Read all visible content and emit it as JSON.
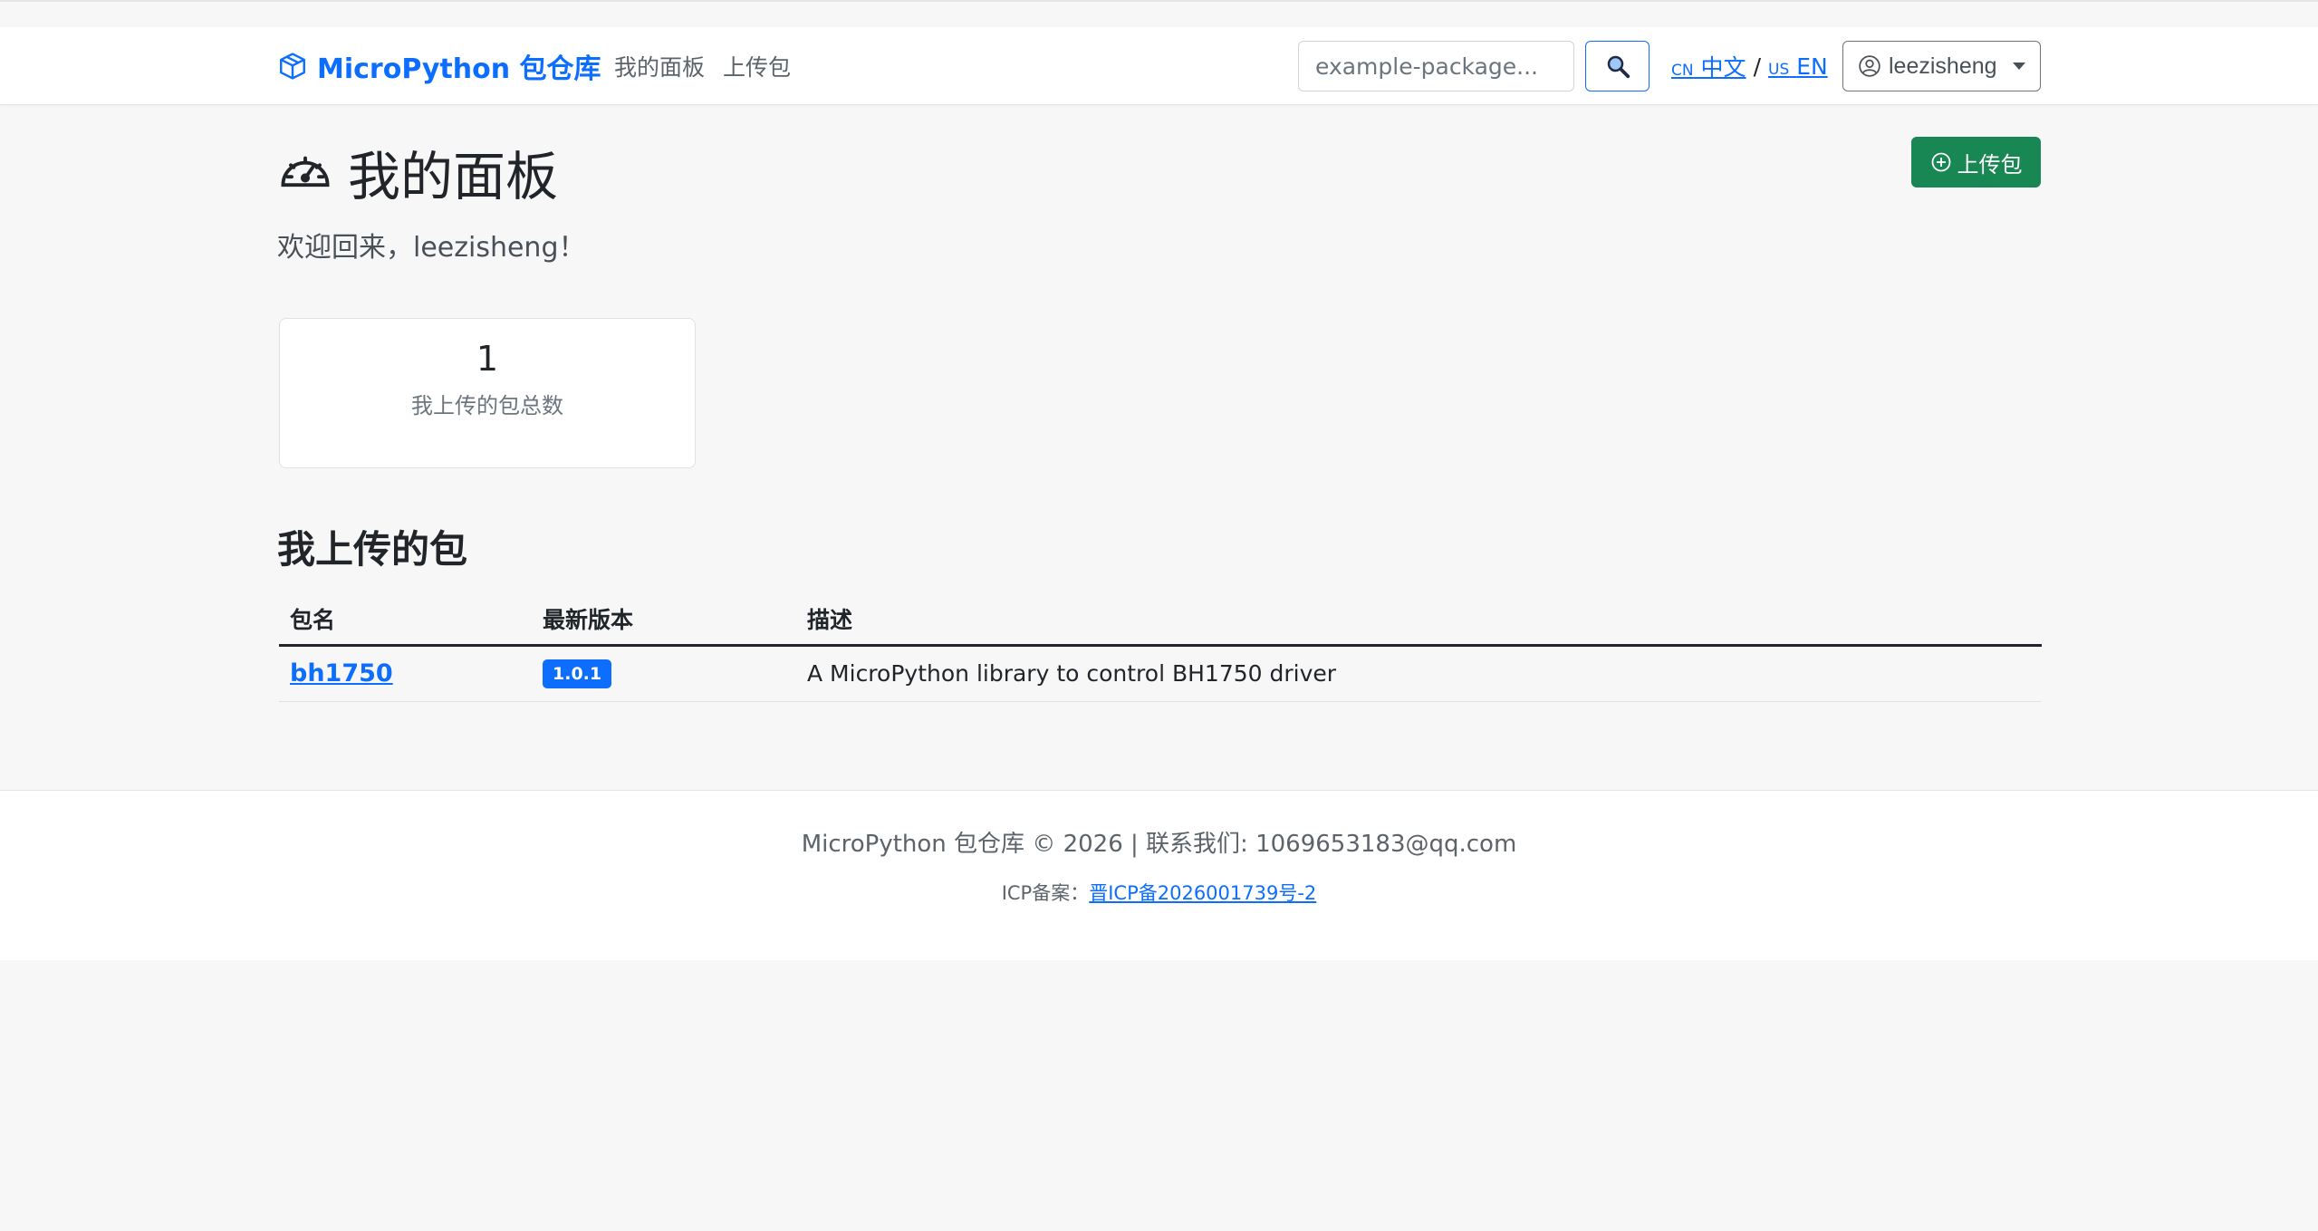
{
  "navbar": {
    "brand": "MicroPython 包仓库",
    "links": [
      "我的面板",
      "上传包"
    ],
    "search_placeholder": "example-package...",
    "lang_cn_code": "CN",
    "lang_cn_label": "中文",
    "lang_separator": "/",
    "lang_us_code": "US",
    "lang_en_label": "EN",
    "username": "leezisheng"
  },
  "main": {
    "title": "我的面板",
    "upload_button": "上传包",
    "welcome": "欢迎回来，leezisheng！",
    "stat": {
      "value": "1",
      "label": "我上传的包总数"
    },
    "section_title": "我上传的包",
    "table": {
      "headers": [
        "包名",
        "最新版本",
        "描述"
      ],
      "rows": [
        {
          "name": "bh1750",
          "version": "1.0.1",
          "description": "A MicroPython library to control BH1750 driver"
        }
      ]
    }
  },
  "footer": {
    "copyright": "MicroPython 包仓库 © 2026 | 联系我们: 1069653183@qq.com",
    "icp_label": "ICP备案：",
    "icp_link": "晋ICP备2026001739号-2"
  },
  "colors": {
    "primary": "#0d6efd",
    "success": "#198754",
    "background": "#f7f7f8"
  },
  "icons": [
    "box-icon",
    "search-icon",
    "user-circle-icon",
    "speedometer-icon",
    "plus-circle-icon"
  ]
}
